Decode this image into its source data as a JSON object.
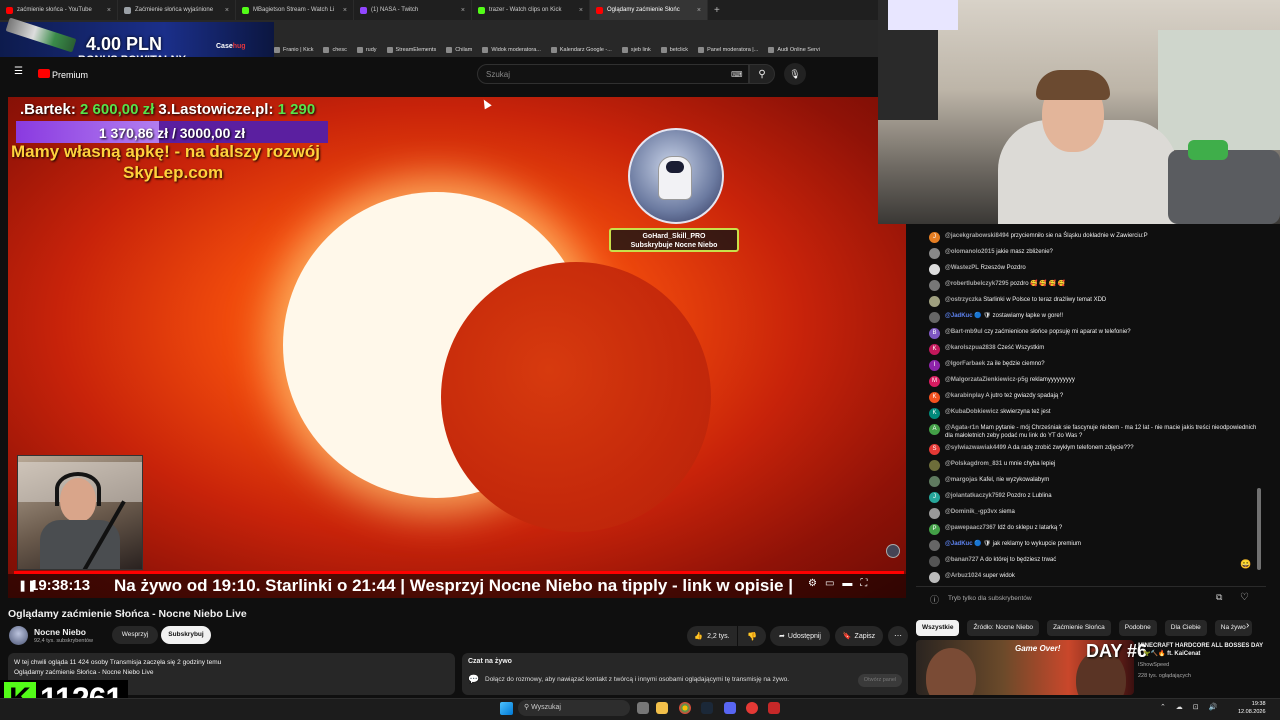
{
  "browser": {
    "tabs": [
      {
        "label": "zaćmienie słońca - YouTube",
        "color": "#ff0000",
        "active": false
      },
      {
        "label": "Zaćmienie słońca wyjaśnione",
        "color": "#9aa0a6",
        "active": false
      },
      {
        "label": "MBagietson Stream - Watch Li",
        "color": "#53fc18",
        "active": false
      },
      {
        "label": "(1) NASA - Twitch",
        "color": "#9146ff",
        "active": false
      },
      {
        "label": "trazer - Watch clips on Kick",
        "color": "#53fc18",
        "active": false
      },
      {
        "label": "Oglądamy zaćmienie Słońc",
        "color": "#ff0000",
        "active": true
      }
    ],
    "new_tab": "+",
    "bookmarks": [
      "Franio | Kick",
      "chesc",
      "rudy",
      "StreamElements",
      "Chilam",
      "Widok moderatora...",
      "Kalendarz Google -...",
      "sjeb link",
      "betclick",
      "Panel moderatora |...",
      "Audi Online Servi"
    ]
  },
  "ad": {
    "amount": "4.00 PLN",
    "bonus": "BONUS POWITALNY",
    "brand_a": "Case",
    "brand_b": "hug"
  },
  "youtube": {
    "logo": "Premium",
    "search_placeholder": "Szukaj",
    "search_icon": "search-icon",
    "mic_icon": "mic-icon"
  },
  "overlay": {
    "donors_prefix": ".Bartek: ",
    "donor1_amount": "2 600,00 zł",
    "donor2": " 3.Lastowicze.pl: ",
    "donor2_amount": "1 290",
    "goal_amount": "1 370,86 zł / 3000,00 zł",
    "goal_fraction": 0.457,
    "apka_line1": "Mamy własną apkę! - na dalszy rozwój",
    "apka_line2": "SkyLep.com",
    "sub_alert_line1": "GoHard_Skill_PRO",
    "sub_alert_line2": "Subskrybuje Nocne Niebo",
    "ticker": "Na żywo od 19:10. Starlinki o 21:44 |  Wesprzyj Nocne Niebo na tipply - link w opisie  |",
    "time": "19:38:13"
  },
  "video": {
    "title": "Oglądamy zaćmienie Słońca - Nocne Niebo Live",
    "channel": "Nocne Niebo",
    "subs": "92,4 tys. subskrybentów",
    "support_btn": "Wesprzyj",
    "subscribe_btn": "Subskrybuj",
    "likes": "2,2 tys.",
    "share": "Udostępnij",
    "save": "Zapisz",
    "desc_line1": "W tej chwili ogląda 11 424 osoby  Transmisja zaczęła się 2 godziny temu",
    "desc_line2": "Oglądamy zaćmienie Słońca - Nocne Niebo Live"
  },
  "chat_info": {
    "title": "Czat na żywo",
    "text": "Dołącz do rozmowy, aby nawiązać kontakt z twórcą i innymi osobami oglądającymi tę transmisję na żywo.",
    "open_btn": "Otwórz panel"
  },
  "kick": {
    "logo": "K",
    "count": "11261"
  },
  "chat": {
    "messages": [
      {
        "user": "@jacekgrabowski8494",
        "text": "przyciemniło sie na Śląsku dokładnie w Zawierciu:P",
        "color": "#e67e22",
        "initial": "J",
        "mod": false
      },
      {
        "user": "@olomanolo2015",
        "text": "jakie masz zbliżenie?",
        "color": "#888888",
        "initial": "",
        "mod": false
      },
      {
        "user": "@WastezPL",
        "text": "Rzeszów Pozdro",
        "color": "#dddddd",
        "initial": "",
        "mod": false
      },
      {
        "user": "@robertlubelczyk7295",
        "text": "pozdro 🥰 🥰 🥰 🥰",
        "color": "#777777",
        "initial": "",
        "mod": false
      },
      {
        "user": "@ostrzyczka",
        "text": "Starlinki w Polsce to teraz drażliwy temat XDD",
        "color": "#a0a080",
        "initial": "",
        "mod": false
      },
      {
        "user": "@JadKuc",
        "text": "zostawiamy łapke w gore!!",
        "color": "#666666",
        "initial": "",
        "mod": true
      },
      {
        "user": "@Bart-mb9ul",
        "text": "czy zaćmienione słońce popsuję mi aparat w telefonie?",
        "color": "#7e57c2",
        "initial": "B",
        "mod": false
      },
      {
        "user": "@karolszpua2838",
        "text": "Cześć Wszystkim",
        "color": "#c2185b",
        "initial": "K",
        "mod": false
      },
      {
        "user": "@IgorFarbaek",
        "text": "za ile będzie ciemno?",
        "color": "#8e24aa",
        "initial": "I",
        "mod": false
      },
      {
        "user": "@MalgorzataZienkiewicz-p5g",
        "text": "reklamyyyyyyyyy",
        "color": "#d81b60",
        "initial": "M",
        "mod": false
      },
      {
        "user": "@karabinplay",
        "text": "A jutro też gwiazdy spadają ?",
        "color": "#f4511e",
        "initial": "K",
        "mod": false
      },
      {
        "user": "@KubaDobkiewicz",
        "text": "skwierzyna też jest",
        "color": "#00897b",
        "initial": "K",
        "mod": false
      },
      {
        "user": "@Agata-r1n",
        "text": "Mam pytanie - mój Chrześniak sie fascynuje niebem - ma 12 lat - nie macie jakis treści nieodpowiednich dla małoletnich zeby podać mu link do YT do Was ?",
        "color": "#43a047",
        "initial": "A",
        "mod": false
      },
      {
        "user": "@sylwiazwawiak4499",
        "text": "A da radę zrobić zwykłym telefonem zdjęcie???",
        "color": "#e53935",
        "initial": "S",
        "mod": false
      },
      {
        "user": "@Polskagdrom_831",
        "text": "u mnie chyba lepiej",
        "color": "#6d6d3a",
        "initial": "",
        "mod": false
      },
      {
        "user": "@margojas",
        "text": "Kafel, nie wyzykowalabym",
        "color": "#5f7a5f",
        "initial": "",
        "mod": false
      },
      {
        "user": "@jolantatkaczyk7592",
        "text": "Pozdro z Lublina",
        "color": "#26a69a",
        "initial": "J",
        "mod": false
      },
      {
        "user": "@Dominik_-gp3vx",
        "text": "siema",
        "color": "#999999",
        "initial": "",
        "mod": false
      },
      {
        "user": "@pawepaacz7367",
        "text": "Idź do sklepu z latarką ?",
        "color": "#43a047",
        "initial": "P",
        "mod": false
      },
      {
        "user": "@JadKuc",
        "text": "jak reklamy to wykupcie premium",
        "color": "#666666",
        "initial": "",
        "mod": true
      },
      {
        "user": "@banan727",
        "text": "A do której to będziesz trwać",
        "color": "#555555",
        "initial": "",
        "mod": false
      },
      {
        "user": "@Arbuz1024",
        "text": "super widok",
        "color": "#bbbbbb",
        "initial": "",
        "mod": false
      }
    ],
    "input_placeholder": "Tryb tylko dla subskrybentów"
  },
  "chips": [
    "Wszystkie",
    "Źródło: Nocne Niebo",
    "Zaćmienie Słońca",
    "Podobne",
    "Dla Ciebie",
    "Na żywo"
  ],
  "recommended": {
    "thumb_text": "DAY #6",
    "thumb_sub": "Game Over!",
    "title": "MINECRAFT HARDCORE ALL BOSSES DAY 6 🦖🔨🔥 ft. KaiCenat",
    "channel": "IShowSpeed",
    "views": "228 tys. oglądających"
  },
  "taskbar": {
    "search": "Wyszukaj",
    "time": "19:38",
    "date": "12.08.2026"
  }
}
